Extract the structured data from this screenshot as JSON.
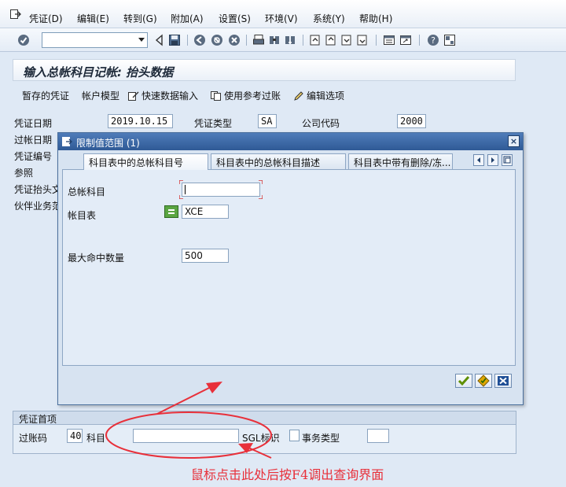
{
  "menu": {
    "items": [
      "凭证(D)",
      "编辑(E)",
      "转到(G)",
      "附加(A)",
      "设置(S)",
      "环境(V)",
      "系统(Y)",
      "帮助(H)"
    ]
  },
  "toolbar": {
    "command_field_value": ""
  },
  "page": {
    "title": "输入总帐科目记帐: 抬头数据"
  },
  "app_toolbar": {
    "saved_docs": "暂存的凭证",
    "account_model": "帐户模型",
    "fast_entry": "快速数据输入",
    "use_reference": "使用参考过账",
    "edit_options": "编辑选项"
  },
  "header": {
    "doc_date_label": "凭证日期",
    "doc_date_value": "2019.10.15",
    "doc_type_label": "凭证类型",
    "doc_type_value": "SA",
    "company_code_label": "公司代码",
    "company_code_value": "2000",
    "posting_date_label": "过帐日期",
    "doc_number_label": "凭证编号",
    "reference_label": "参照",
    "header_text_label": "凭证抬头文",
    "partner_label": "伙伴业务范"
  },
  "first_item": {
    "group_title": "凭证首项",
    "posting_key_label": "过账码",
    "posting_key_value": "40",
    "account_label": "科目",
    "account_value": "",
    "sgl_label": "SGL标识",
    "transaction_type_label": "事务类型",
    "transaction_type_value": ""
  },
  "dialog": {
    "title": "限制值范围 (1)",
    "close": "×",
    "tabs": [
      "科目表中的总帐科目号",
      "科目表中的总帐科目描述",
      "科目表中带有删除/冻..."
    ],
    "gl_account_label": "总帐科目",
    "gl_account_value": "",
    "chart_label": "帐目表",
    "chart_value": "XCE",
    "max_hits_label": "最大命中数量",
    "max_hits_value": "500"
  },
  "annotation": {
    "text": "鼠标点击此处后按F4调出查询界面"
  },
  "colors": {
    "annotation_red": "#e8303a",
    "title_bar_blue": "#2f5a96",
    "background": "#dfe9f5"
  }
}
